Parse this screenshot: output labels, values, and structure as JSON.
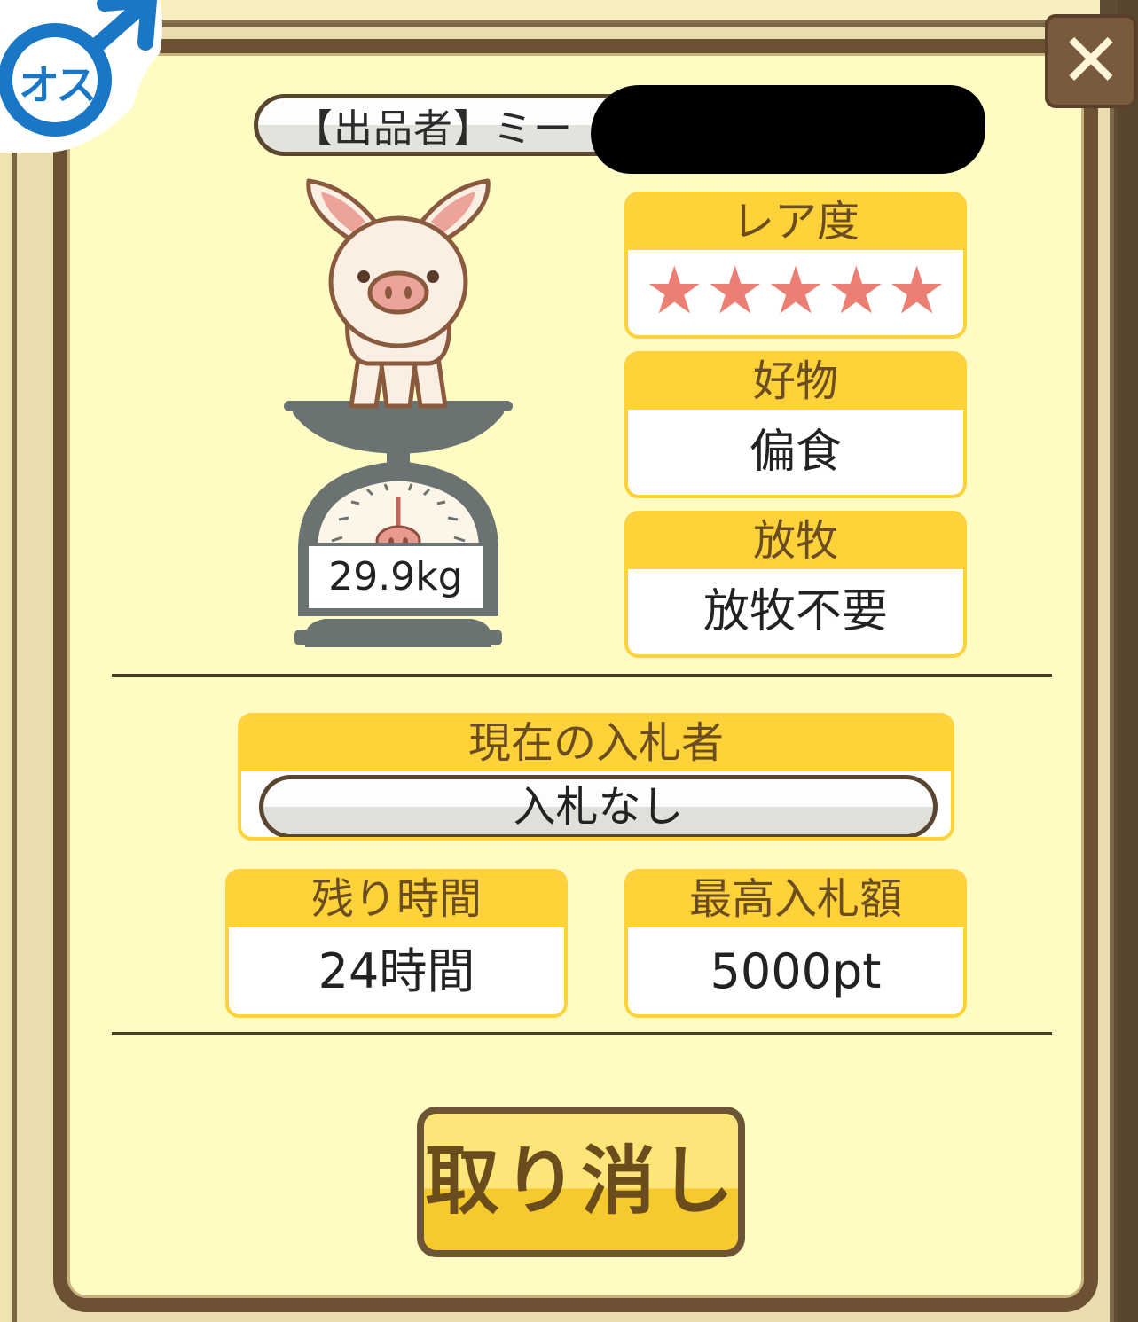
{
  "gender": {
    "label": "オス",
    "icon": "male-symbol-icon"
  },
  "close": {
    "label": "✕",
    "icon": "close-icon"
  },
  "seller": {
    "label": "【出品者】ミー"
  },
  "pig": {
    "weight": "29.9kg"
  },
  "rarity": {
    "label": "レア度",
    "stars": 5,
    "star_glyph": "★"
  },
  "favorite_food": {
    "label": "好物",
    "value": "偏食"
  },
  "grazing": {
    "label": "放牧",
    "value": "放牧不要"
  },
  "current_bidder": {
    "label": "現在の入札者",
    "value": "入札なし"
  },
  "remaining_time": {
    "label": "残り時間",
    "value": "24時間"
  },
  "highest_bid": {
    "label": "最高入札額",
    "value": "5000pt"
  },
  "cancel_button": {
    "label": "取り消し"
  },
  "colors": {
    "panel_bg": "#fffcc3",
    "frame": "#6d5133",
    "header_yellow": "#ffd23a",
    "star": "#ec7f73",
    "male_blue": "#1977c6"
  }
}
